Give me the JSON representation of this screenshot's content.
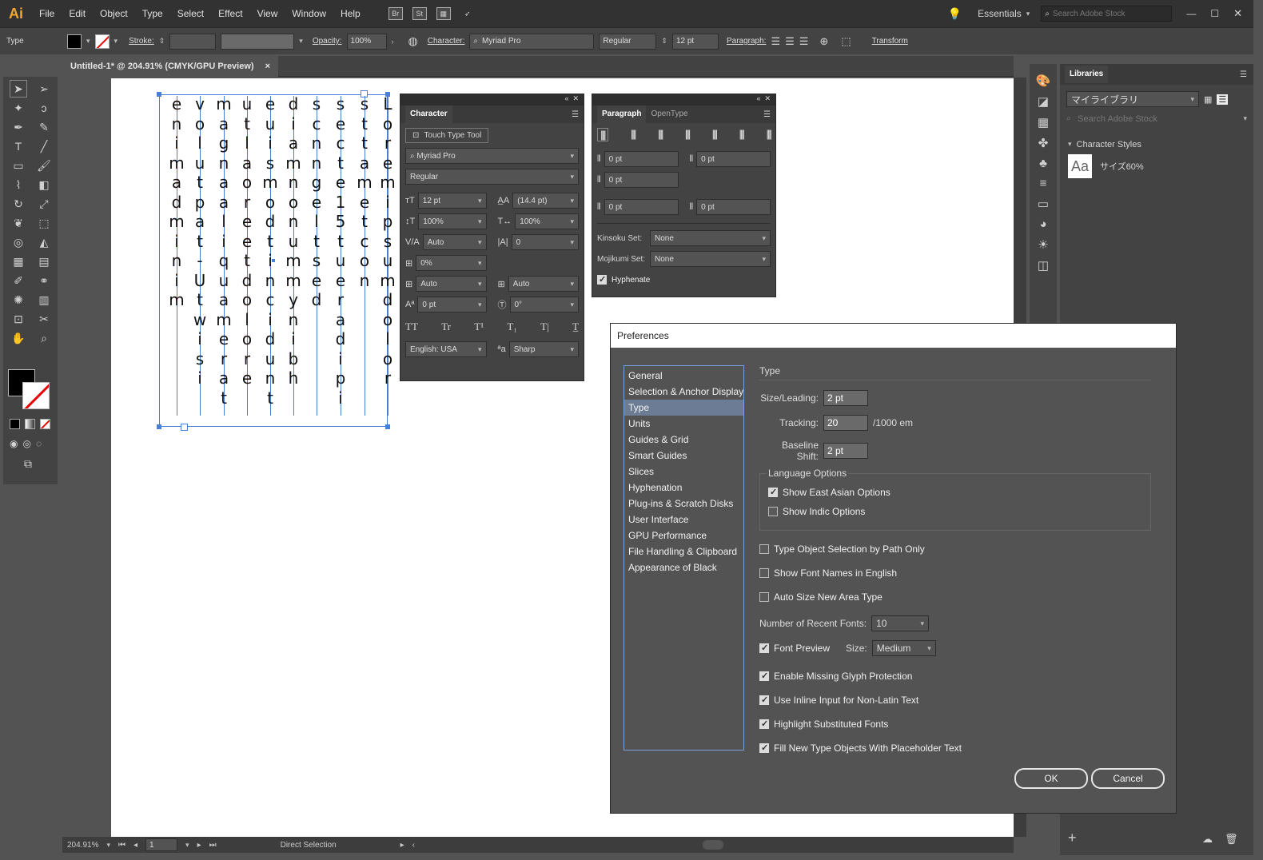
{
  "app": {
    "logo": "Ai",
    "menus": [
      "File",
      "Edit",
      "Object",
      "Type",
      "Select",
      "Effect",
      "View",
      "Window",
      "Help"
    ],
    "workspace": "Essentials",
    "search_placeholder": "Search Adobe Stock",
    "mb_icons": [
      "Br",
      "St"
    ]
  },
  "control": {
    "type_label": "Type",
    "stroke_label": "Stroke:",
    "opacity_label": "Opacity:",
    "opacity_value": "100%",
    "character_label": "Character:",
    "font": "Myriad Pro",
    "style": "Regular",
    "size": "12 pt",
    "paragraph_label": "Paragraph:",
    "transform_label": "Transform"
  },
  "document": {
    "tab_title": "Untitled-1* @ 204.91% (CMYK/GPU Preview)",
    "close": "×"
  },
  "artwork": {
    "columns": [
      [
        "e",
        "n",
        "i",
        "m",
        "a",
        "d",
        "m",
        "i",
        "n",
        "i",
        "m"
      ],
      [
        "v",
        "o",
        "l",
        "u",
        "t",
        "p",
        "a",
        "t",
        "-",
        "U",
        "t",
        "w",
        "i",
        "s",
        "i"
      ],
      [
        "m",
        "a",
        "g",
        "n",
        "a",
        "a",
        "l",
        "i",
        "q",
        "u",
        "a",
        "m",
        "e",
        "r",
        "a",
        "t"
      ],
      [
        "u",
        "t",
        "l",
        "a",
        "o",
        "r",
        "e",
        "e",
        "t",
        "d",
        "o",
        "l",
        "o",
        "r",
        "e"
      ],
      [
        "e",
        "u",
        "i",
        "s",
        "m",
        "o",
        "d",
        "t",
        "i",
        "n",
        "c",
        "i",
        "d",
        "u",
        "n",
        "t"
      ],
      [
        "d",
        "i",
        "a",
        "m",
        "n",
        "o",
        "n",
        "u",
        "m",
        "m",
        "y",
        "n",
        "i",
        "b",
        "h"
      ],
      [
        "s",
        "c",
        "n",
        "n",
        "g",
        "e",
        "l",
        "t",
        "s",
        "e",
        "d"
      ],
      [
        "s",
        "e",
        "c",
        "t",
        "e",
        "1",
        "5",
        "t",
        "u",
        "e",
        "r",
        "a",
        "d",
        "i",
        "p",
        "i"
      ],
      [
        "s",
        "t",
        "t",
        "a",
        "m",
        "e",
        "t",
        "c",
        "o",
        "n"
      ],
      [
        "L",
        "o",
        "r",
        "e",
        "m",
        "i",
        "p",
        "s",
        "u",
        "m",
        "d",
        "o",
        "l",
        "o",
        "r"
      ]
    ]
  },
  "character_panel": {
    "title": "Character",
    "touch_type": "Touch Type Tool",
    "font": "Myriad Pro",
    "style": "Regular",
    "size": "12 pt",
    "leading": "(14.4 pt)",
    "vscale": "100%",
    "hscale": "100%",
    "kerning": "Auto",
    "tracking": "0",
    "tsume": "0%",
    "aki_left": "Auto",
    "aki_right": "Auto",
    "baseline": "0 pt",
    "rotation": "0°",
    "language": "English: USA",
    "antialias": "Sharp",
    "caps": [
      "TT",
      "Tr",
      "T¹",
      "T₁",
      "T|",
      "T̲"
    ]
  },
  "paragraph_panel": {
    "tab1": "Paragraph",
    "tab2": "OpenType",
    "left_indent": "0 pt",
    "right_indent": "0 pt",
    "first_indent": "0 pt",
    "space_before": "0 pt",
    "space_after": "0 pt",
    "kinsoku_label": "Kinsoku Set:",
    "kinsoku": "None",
    "mojikumi_label": "Mojikumi Set:",
    "mojikumi": "None",
    "hyphenate": "Hyphenate"
  },
  "libraries": {
    "title": "Libraries",
    "library": "マイライブラリ",
    "search_placeholder": "Search Adobe Stock",
    "char_styles": "Character Styles",
    "style_preview": "Aa",
    "style_name": "サイズ60%"
  },
  "status": {
    "zoom": "204.91%",
    "page": "1",
    "tool": "Direct Selection"
  },
  "dialog": {
    "title": "Preferences",
    "categories": [
      "General",
      "Selection & Anchor Display",
      "Type",
      "Units",
      "Guides & Grid",
      "Smart Guides",
      "Slices",
      "Hyphenation",
      "Plug-ins & Scratch Disks",
      "User Interface",
      "GPU Performance",
      "File Handling & Clipboard",
      "Appearance of Black"
    ],
    "selected_index": 2,
    "section": "Type",
    "size_leading_label": "Size/Leading:",
    "size_leading": "2 pt",
    "tracking_label": "Tracking:",
    "tracking": "20",
    "tracking_unit": "/1000 em",
    "baseline_label": "Baseline Shift:",
    "baseline": "2 pt",
    "lang_title": "Language Options",
    "east_asian": "Show East Asian Options",
    "indic": "Show Indic Options",
    "type_sel": "Type Object Selection by Path Only",
    "font_english": "Show Font Names in English",
    "auto_size": "Auto Size New Area Type",
    "recent_label": "Number of Recent Fonts:",
    "recent": "10",
    "font_preview": "Font Preview",
    "size_label": "Size:",
    "size": "Medium",
    "missing_glyph": "Enable Missing Glyph Protection",
    "inline_input": "Use Inline Input for Non-Latin Text",
    "highlight": "Highlight Substituted Fonts",
    "fill_placeholder": "Fill New Type Objects With Placeholder Text",
    "ok": "OK",
    "cancel": "Cancel"
  }
}
